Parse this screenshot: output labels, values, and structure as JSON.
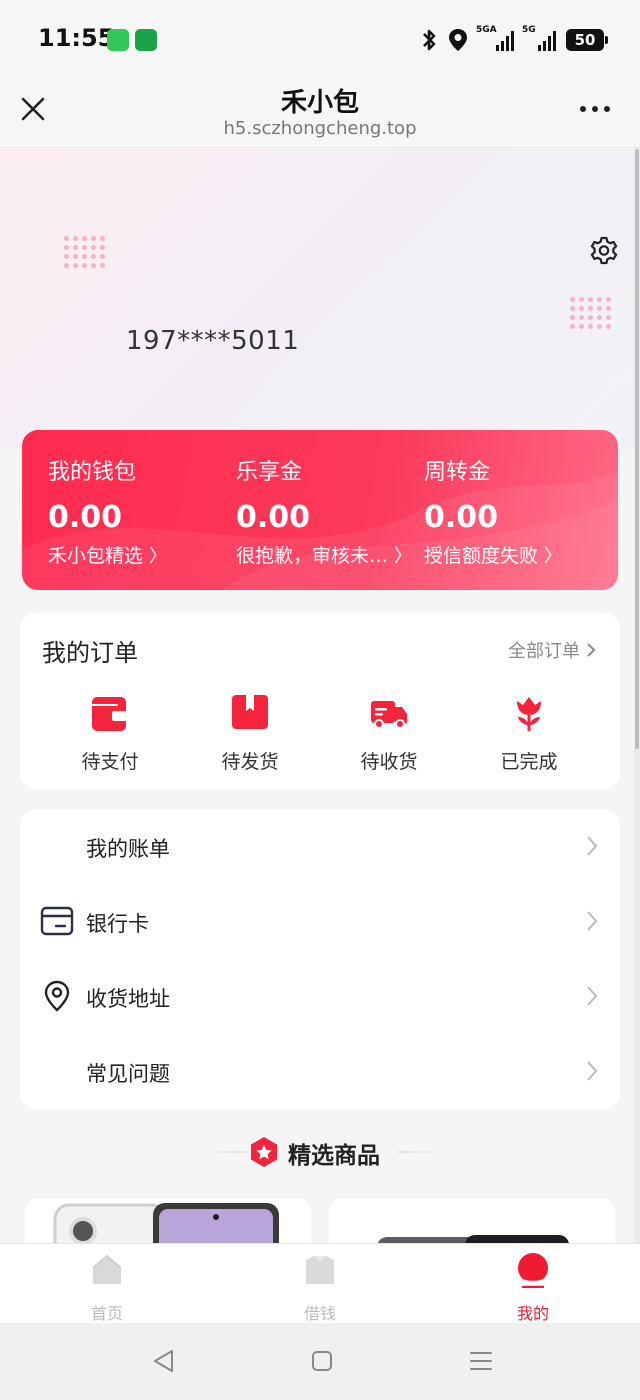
{
  "status_bar": {
    "time": "11:55",
    "network_1": "5GA",
    "network_2": "5G",
    "battery": "50"
  },
  "header": {
    "title": "禾小包",
    "url": "h5.sczhongcheng.top"
  },
  "profile": {
    "phone": "197****5011"
  },
  "wallet": [
    {
      "label": "我的钱包",
      "value": "0.00",
      "link": "禾小包精选"
    },
    {
      "label": "乐享金",
      "value": "0.00",
      "link": "很抱歉，审核未…"
    },
    {
      "label": "周转金",
      "value": "0.00",
      "link": "授信额度失败"
    }
  ],
  "orders": {
    "title": "我的订单",
    "all_label": "全部订单",
    "items": [
      {
        "label": "待支付",
        "icon": "wallet-icon"
      },
      {
        "label": "待发货",
        "icon": "package-icon"
      },
      {
        "label": "待收货",
        "icon": "truck-icon"
      },
      {
        "label": "已完成",
        "icon": "flower-icon"
      }
    ]
  },
  "menu": [
    {
      "label": "我的账单",
      "icon": ""
    },
    {
      "label": "银行卡",
      "icon": "bank-card-icon"
    },
    {
      "label": "收货地址",
      "icon": "location-pin-icon"
    },
    {
      "label": "常见问题",
      "icon": ""
    }
  ],
  "featured": {
    "title": "精选商品"
  },
  "tabs": [
    {
      "label": "首页",
      "icon": "home-icon",
      "active": false
    },
    {
      "label": "借钱",
      "icon": "bag-icon",
      "active": false
    },
    {
      "label": "我的",
      "icon": "profile-icon",
      "active": true
    }
  ],
  "colors": {
    "accent": "#fe2d52",
    "tab_active": "#e8203c",
    "page_bg": "#f5f5f5"
  }
}
